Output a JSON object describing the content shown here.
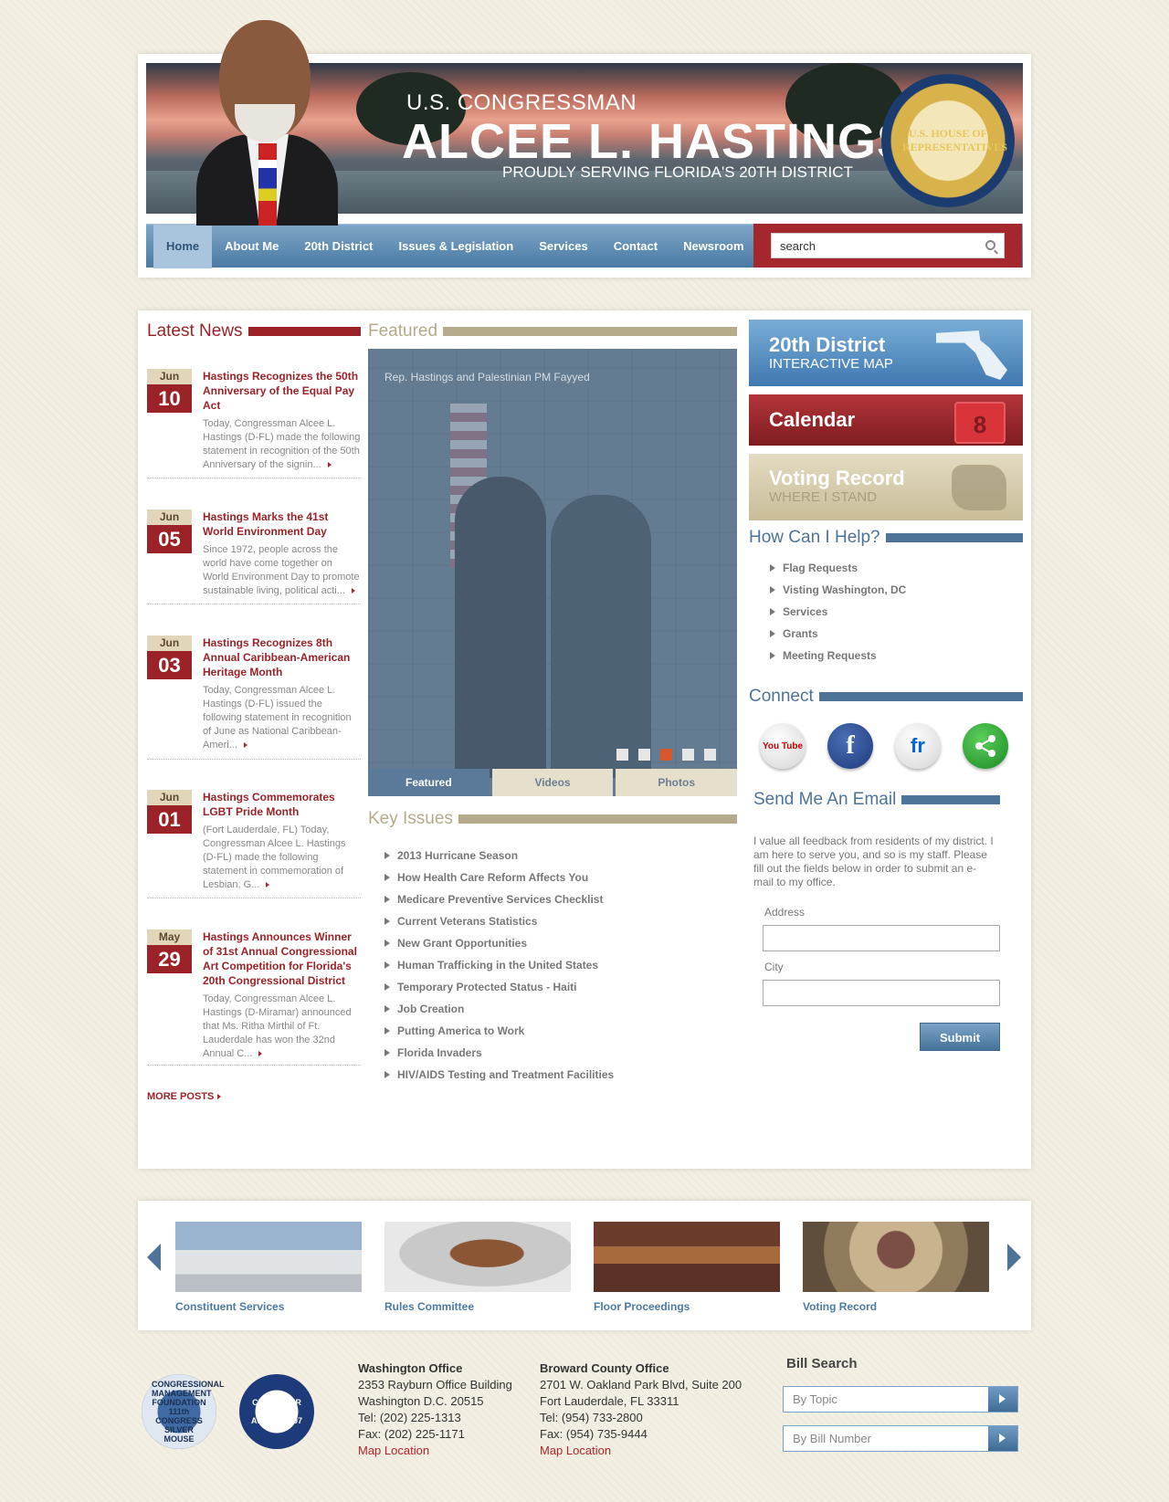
{
  "banner": {
    "line1": "U.S. CONGRESSMAN",
    "line2": "ALCEE L. HASTINGS",
    "line3": "PROUDLY SERVING FLORIDA'S 20TH DISTRICT",
    "seal_text": "U.S. HOUSE OF REPRESENTATIVES"
  },
  "nav": {
    "items": [
      "Home",
      "About Me",
      "20th District",
      "Issues & Legislation",
      "Services",
      "Contact",
      "Newsroom"
    ],
    "search_value": "search"
  },
  "latest_news": {
    "title": "Latest News",
    "items": [
      {
        "month": "Jun",
        "day": "10",
        "title": "Hastings Recognizes the 50th Anniversary of the Equal Pay Act",
        "excerpt": "Today, Congressman Alcee L. Hastings (D-FL) made the following statement in recognition of the 50th Anniversary of the signin..."
      },
      {
        "month": "Jun",
        "day": "05",
        "title": "Hastings Marks the 41st World Environment Day",
        "excerpt": "Since 1972, people across the world have come together on World Environment Day to promote sustainable living, political acti..."
      },
      {
        "month": "Jun",
        "day": "03",
        "title": "Hastings Recognizes 8th Annual Caribbean-American Heritage Month",
        "excerpt": "Today, Congressman Alcee L. Hastings (D-FL) issued the following statement in recognition of June as National Caribbean-Ameri..."
      },
      {
        "month": "Jun",
        "day": "01",
        "title": "Hastings Commemorates LGBT Pride Month",
        "excerpt": "(Fort Lauderdale, FL) Today, Congressman Alcee L. Hastings (D-FL) made the following statement in commemoration of Lesbian, G..."
      },
      {
        "month": "May",
        "day": "29",
        "title": "Hastings Announces Winner of 31st Annual Congressional Art Competition for Florida's 20th Congressional District",
        "excerpt": "Today, Congressman Alcee L. Hastings (D-Miramar) announced that Ms. Ritha Mirthil of Ft. Lauderdale has won the 32nd Annual C..."
      }
    ],
    "more": "MORE POSTS"
  },
  "featured": {
    "title": "Featured",
    "caption": "Rep. Hastings and Palestinian PM Fayyed",
    "active_slide": 3,
    "tabs": [
      "Featured",
      "Videos",
      "Photos"
    ]
  },
  "key_issues": {
    "title": "Key Issues",
    "items": [
      "2013 Hurricane Season",
      "How Health Care Reform Affects You",
      "Medicare Preventive Services Checklist",
      "Current Veterans Statistics",
      "New Grant Opportunities",
      "Human Trafficking in the United States",
      "Temporary Protected Status - Haiti",
      "Job Creation",
      "Putting America to Work",
      "Florida Invaders",
      "HIV/AIDS Testing and Treatment Facilities"
    ]
  },
  "tiles": {
    "district": {
      "title": "20th District",
      "sub": "INTERACTIVE MAP"
    },
    "calendar": {
      "title": "Calendar",
      "icon_num": "8"
    },
    "voting": {
      "title": "Voting Record",
      "sub": "WHERE I STAND"
    }
  },
  "help": {
    "title": "How Can I Help?",
    "items": [
      "Flag Requests",
      "Visting Washington, DC",
      "Services",
      "Grants",
      "Meeting Requests"
    ]
  },
  "connect": {
    "title": "Connect",
    "icons": [
      "youtube-icon",
      "facebook-icon",
      "flickr-icon",
      "share-icon"
    ],
    "yt": "You Tube",
    "fb": "f",
    "fr": "fr"
  },
  "email": {
    "title": "Send Me An Email",
    "text": "I value all feedback from residents of my district. I am here to serve you, and so is my staff. Please fill out the fields below in order to submit an e-mail to my office.",
    "address_label": "Address",
    "city_label": "City",
    "submit": "Submit"
  },
  "carousel": {
    "items": [
      "Constituent Services",
      "Rules Committee",
      "Floor Proceedings",
      "Voting Record"
    ]
  },
  "footer": {
    "badge1": "CONGRESSIONAL MANAGEMENT FOUNDATION 111th CONGRESS SILVER MOUSE",
    "badge2": "CMF SILVER MOUSE AWARD 2007",
    "dc": {
      "title": "Washington Office",
      "l1": "2353 Rayburn Office Building",
      "l2": "Washington D.C. 20515",
      "tel": "Tel: (202) 225-1313",
      "fax": "Fax: (202) 225-1171",
      "map": "Map Location"
    },
    "broward": {
      "title": "Broward County Office",
      "l1": "2701 W. Oakland Park Blvd, Suite 200",
      "l2": "Fort Lauderdale, FL 33311",
      "tel": "Tel: (954) 733-2800",
      "fax": "Fax: (954) 735-9444",
      "map": "Map Location"
    },
    "bill_search": {
      "title": "Bill Search",
      "topic": "By Topic",
      "number": "By Bill Number"
    }
  },
  "colors": {
    "accent_red": "#9b2328",
    "nav_blue": "#4a7aa3",
    "tan": "#b5ab8a",
    "steel_blue": "#4d7399"
  }
}
